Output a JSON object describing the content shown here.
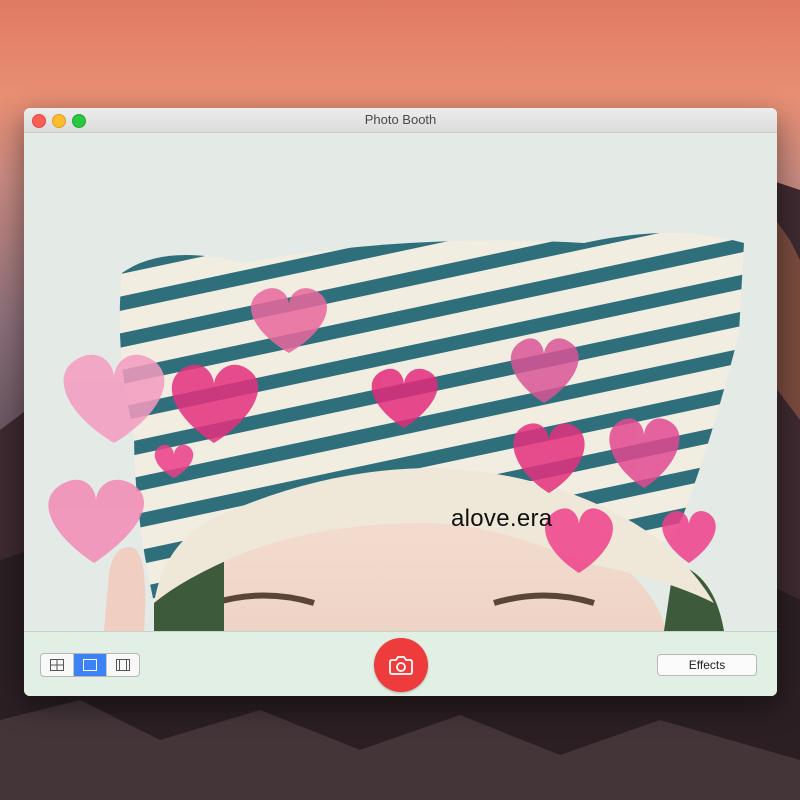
{
  "window": {
    "title": "Photo Booth"
  },
  "watermark": "alove.era",
  "toolbar": {
    "layouts": [
      {
        "name": "four-up",
        "icon": "grid-icon",
        "selected": false
      },
      {
        "name": "single",
        "icon": "single-photo-icon",
        "selected": true
      },
      {
        "name": "video",
        "icon": "filmstrip-icon",
        "selected": false
      }
    ],
    "effects_label": "Effects",
    "shutter_icon": "camera-icon"
  },
  "colors": {
    "accent": "#3b82f6",
    "shutter": "#ee3b3b",
    "close": "#fc5f57",
    "minimize": "#fdbc2e",
    "maximize": "#29c840"
  }
}
